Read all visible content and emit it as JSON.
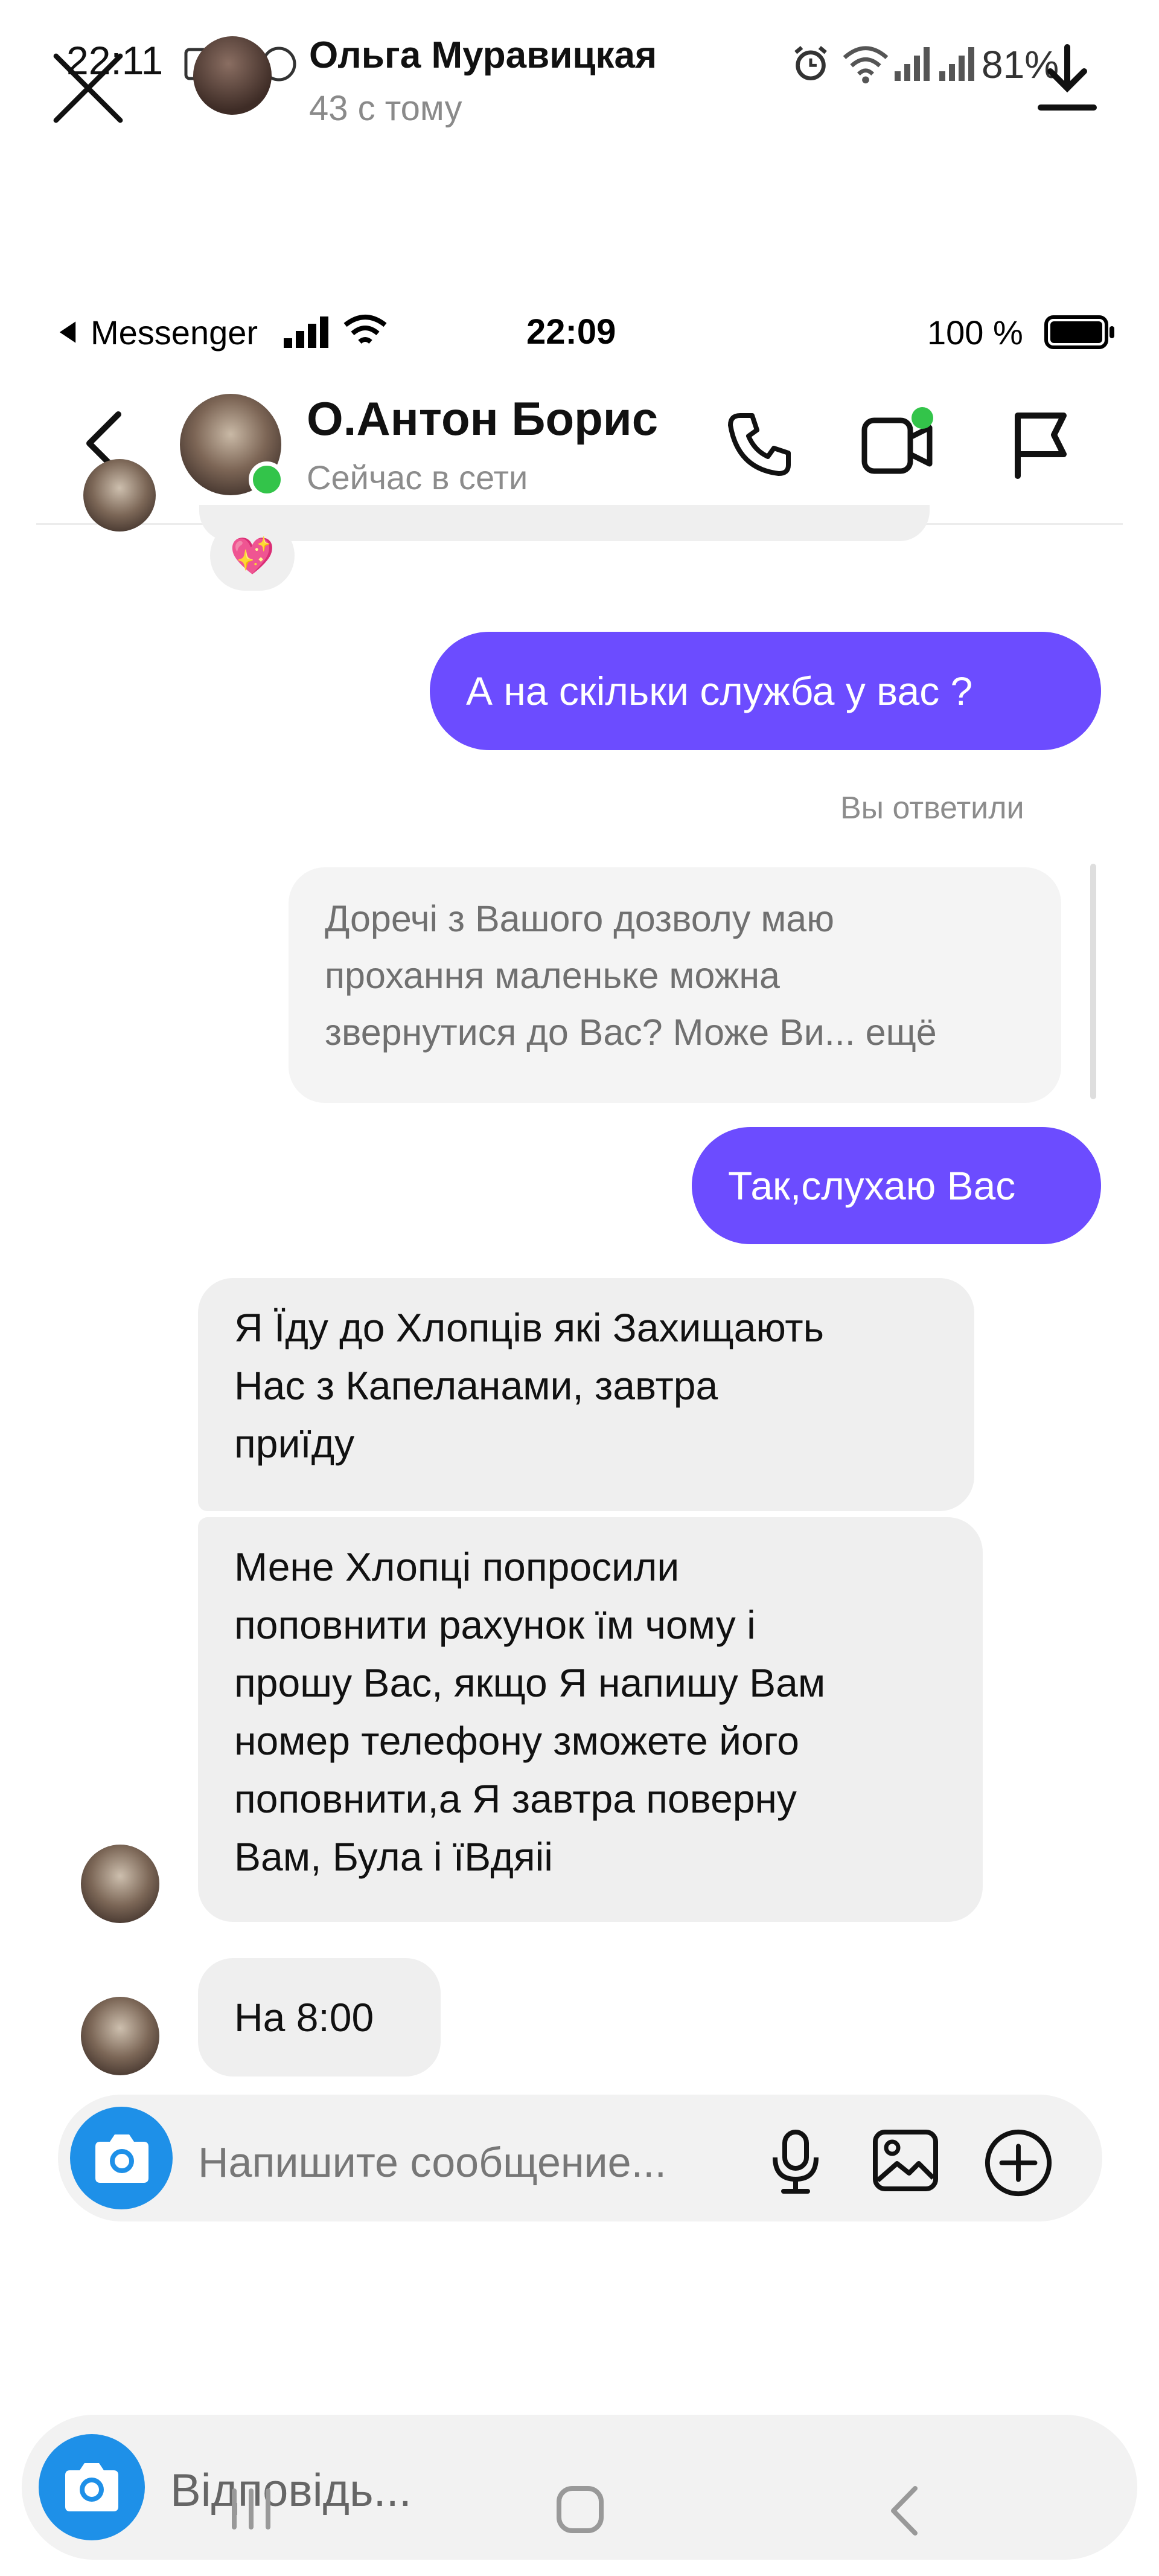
{
  "story_overlay": {
    "time": "22:11",
    "user_name": "Ольга Муравицкая",
    "time_ago": "43 с тому",
    "battery": "81%",
    "reply_placeholder": "Відповідь..."
  },
  "messenger_status_bar": {
    "app_name": "Messenger",
    "time": "22:09",
    "battery": "100 %"
  },
  "chat_header": {
    "contact_name": "О.Антон Борис",
    "status": "Сейчас в сети"
  },
  "conversation": {
    "reaction_emoji": "💖",
    "outgoing_1": "А на скільки служба у вас ?",
    "replied_label": "Вы ответили",
    "quoted_message": {
      "line1": "Доречі з Вашого дозволу маю",
      "line2": "прохання маленьке можна",
      "line3": "звернутися до Вас? Може Ви... ещё"
    },
    "outgoing_2": "Так,слухаю Вас",
    "incoming_1": {
      "line1": "Я Їду до Хлопців які Захищають",
      "line2": "Нас з Капеланами, завтра",
      "line3": "приїду"
    },
    "incoming_2": {
      "line1": "Мене Хлопці попросили",
      "line2": "поповнити рахунок їм чому і",
      "line3": "прошу Вас, якщо Я напишу Вам",
      "line4": "номер телефону зможете його",
      "line5": "поповнити,а Я завтра поверну",
      "line6": "Вам, Була і їВдяіі"
    },
    "incoming_3": "На 8:00"
  },
  "composer": {
    "placeholder": "Напишите сообщение..."
  },
  "colors": {
    "outgoing_bubble": "#6c4cff",
    "incoming_bubble": "#efefef",
    "online_dot": "#33c44a",
    "camera_button": "#1e90e8"
  }
}
